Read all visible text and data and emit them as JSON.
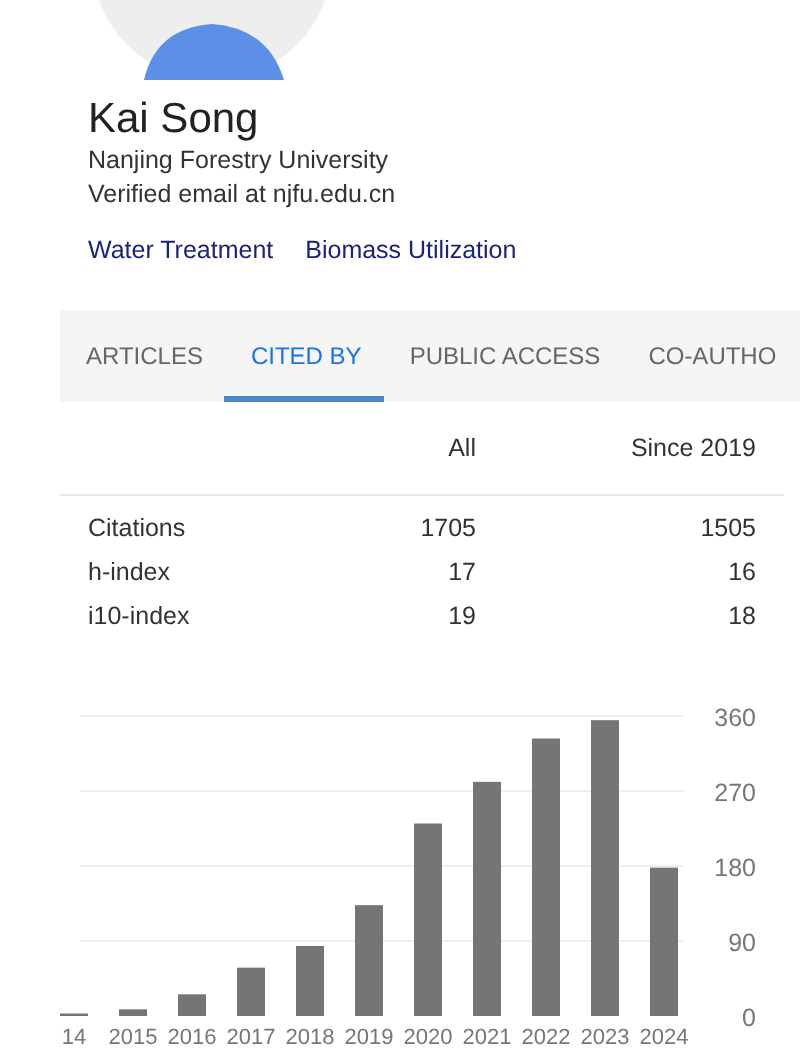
{
  "profile": {
    "name": "Kai Song",
    "affiliation": "Nanjing Forestry University",
    "email": "Verified email at njfu.edu.cn",
    "interests": [
      "Water Treatment",
      "Biomass Utilization"
    ]
  },
  "tabs": [
    {
      "label": "ARTICLES",
      "selected": false
    },
    {
      "label": "CITED BY",
      "selected": true
    },
    {
      "label": "PUBLIC ACCESS",
      "selected": false
    },
    {
      "label": "CO-AUTHO",
      "selected": false
    }
  ],
  "stats": {
    "columns": [
      "All",
      "Since 2019"
    ],
    "rows": [
      {
        "label": "Citations",
        "all": "1705",
        "since": "1505"
      },
      {
        "label": "h-index",
        "all": "17",
        "since": "16"
      },
      {
        "label": "i10-index",
        "all": "19",
        "since": "18"
      }
    ]
  },
  "chart": {
    "chart_data": {
      "type": "bar",
      "categories": [
        "14",
        "2015",
        "2016",
        "2017",
        "2018",
        "2019",
        "2020",
        "2021",
        "2022",
        "2023",
        "2024"
      ],
      "grid": true,
      "series": [
        {
          "color": "#757575",
          "values": [
            3,
            8,
            26,
            58,
            84,
            133,
            231,
            281,
            333,
            355,
            178
          ]
        }
      ],
      "ylim": [
        0,
        360
      ],
      "yticks": [
        0,
        90,
        180,
        270,
        360
      ]
    }
  }
}
